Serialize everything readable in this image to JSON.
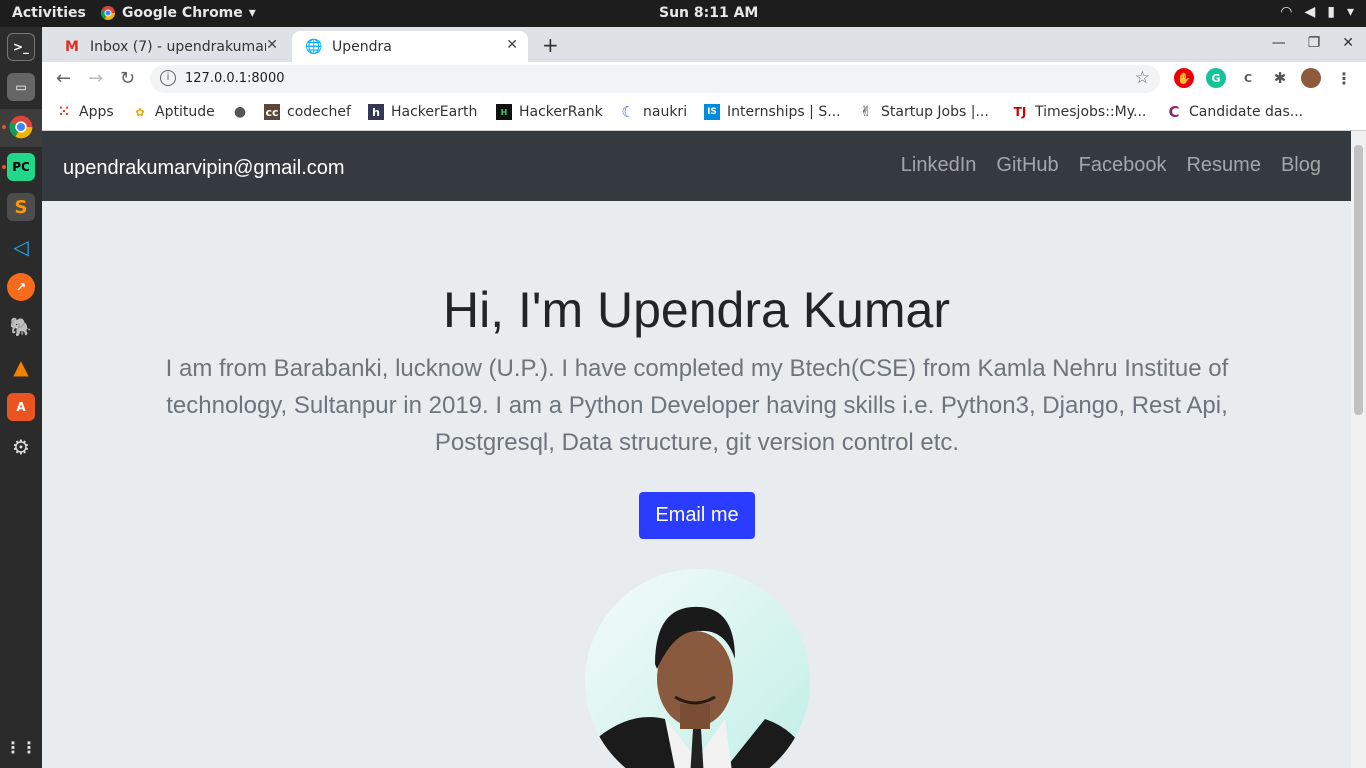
{
  "system": {
    "activities": "Activities",
    "app_menu": "Google Chrome",
    "clock": "Sun  8:11 AM"
  },
  "browser": {
    "tabs": [
      {
        "title": "Inbox (7) - upendrakumar",
        "active": false
      },
      {
        "title": "Upendra",
        "active": true
      }
    ],
    "url": "127.0.0.1:8000",
    "bookmarks": [
      {
        "label": "Apps",
        "icon": "apps-grid-icon"
      },
      {
        "label": "Aptitude",
        "icon": "aptitude-icon"
      },
      {
        "label": "",
        "icon": "globe-icon"
      },
      {
        "label": "codechef",
        "icon": "codechef-icon"
      },
      {
        "label": "HackerEarth",
        "icon": "hackerearth-icon"
      },
      {
        "label": "HackerRank",
        "icon": "hackerrank-icon"
      },
      {
        "label": "naukri",
        "icon": "naukri-icon"
      },
      {
        "label": "Internships | S...",
        "icon": "internshala-icon"
      },
      {
        "label": "Startup Jobs |...",
        "icon": "angellist-icon"
      },
      {
        "label": "Timesjobs::My...",
        "icon": "timesjobs-icon"
      },
      {
        "label": "Candidate das...",
        "icon": "candidate-icon"
      }
    ]
  },
  "page": {
    "brand": "upendrakumarvipin@gmail.com",
    "nav": [
      "LinkedIn",
      "GitHub",
      "Facebook",
      "Resume",
      "Blog"
    ],
    "heading": "Hi, I'm Upendra Kumar",
    "intro": "I am from Barabanki, lucknow (U.P.). I have completed my Btech(CSE) from Kamla Nehru Institue of technology, Sultanpur in 2019. I am a Python Developer having skills i.e. Python3, Django, Rest Api, Postgresql, Data structure, git version control etc.",
    "cta": "Email me"
  },
  "colors": {
    "navbar": "#343a40",
    "hero_bg": "#e9ecef",
    "cta": "#2a3cff"
  }
}
